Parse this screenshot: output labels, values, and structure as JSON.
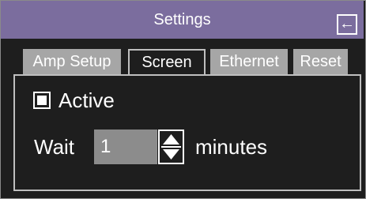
{
  "window": {
    "title": "Settings",
    "back_icon": "back-arrow-icon",
    "back_glyph": "←"
  },
  "tabs": [
    {
      "label": "Amp Setup",
      "active": false
    },
    {
      "label": "Screen",
      "active": true
    },
    {
      "label": "Ethernet",
      "active": false
    },
    {
      "label": "Reset",
      "active": false
    }
  ],
  "screen_panel": {
    "active_checkbox": {
      "label": "Active",
      "checked": true
    },
    "wait": {
      "label": "Wait",
      "value": "1",
      "unit": "minutes"
    }
  },
  "colors": {
    "title_bar": "#7b6d9e",
    "background": "#1e1e1e",
    "tab_inactive": "#a6a6a6",
    "field": "#8c8c8c",
    "text": "#ffffff"
  }
}
